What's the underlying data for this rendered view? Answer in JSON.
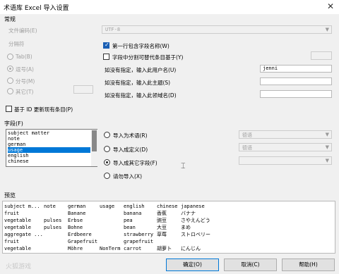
{
  "window": {
    "title": "术语库 Excel 导入设置",
    "close": "✕"
  },
  "general": {
    "heading": "常规",
    "encoding_label": "文件编码(E)",
    "encoding_value": "UTF-8",
    "separator_label": "分隔符",
    "sep_tab": "Tab(B)",
    "sep_comma": "逗号(A)",
    "sep_semicolon": "分号(M)",
    "sep_other": "其它(T)",
    "first_row_header": "第一行包含字段名称(W)",
    "first_row_header_checked": true,
    "split_label": "字段中分割可替代条目基于(Y)",
    "split_checked": false,
    "user_label": "如没有指定，输入此用户名(U)",
    "user_value": "jenni",
    "subject_label": "如没有指定，输入此主题(S)",
    "subject_value": "",
    "domain_label": "如没有指定，输入此领域名(D)",
    "domain_value": "",
    "update_by_id": "基于 ID 更新现有条目(P)"
  },
  "fields": {
    "heading": "字段(F)",
    "items": [
      "subject matter",
      "note",
      "german",
      "usage",
      "english",
      "chinese"
    ],
    "selected_index": 3,
    "opt_term": "导入为术语(R)",
    "opt_definition": "导入成定义(D)",
    "opt_other": "导入成其它字段(F)",
    "opt_ignore": "请勿导入(X)",
    "selected_option": "opt_other",
    "lang_value_1": "德语",
    "lang_value_2": "德语"
  },
  "preview": {
    "heading": "预览",
    "rows": [
      [
        "subject m...",
        "note",
        "german",
        "usage",
        "english",
        "chinese",
        "japanese"
      ],
      [
        "fruit",
        "",
        "Banane",
        "",
        "banana",
        "香蕉",
        "バナナ"
      ],
      [
        "vegetable",
        "pulses",
        "Erbse",
        "",
        "pea",
        "豌豆",
        "さやえんどう"
      ],
      [
        "vegetable",
        "pulses",
        "Bohne",
        "",
        "bean",
        "大豆",
        "まめ"
      ],
      [
        "aggregate ...",
        "",
        "Erdbeere",
        "",
        "strawberry",
        "草莓",
        "ストロベリー"
      ],
      [
        "fruit",
        "",
        "Grapefruit",
        "",
        "grapefruit",
        "",
        ""
      ],
      [
        "vegetable",
        "",
        "Möhre",
        "NonTerm",
        "carrot",
        "胡萝卜",
        "にんじん"
      ]
    ]
  },
  "buttons": {
    "ok": "确定(O)",
    "cancel": "取消(C)",
    "help": "帮助(H)"
  },
  "watermark": "火狐游戏"
}
